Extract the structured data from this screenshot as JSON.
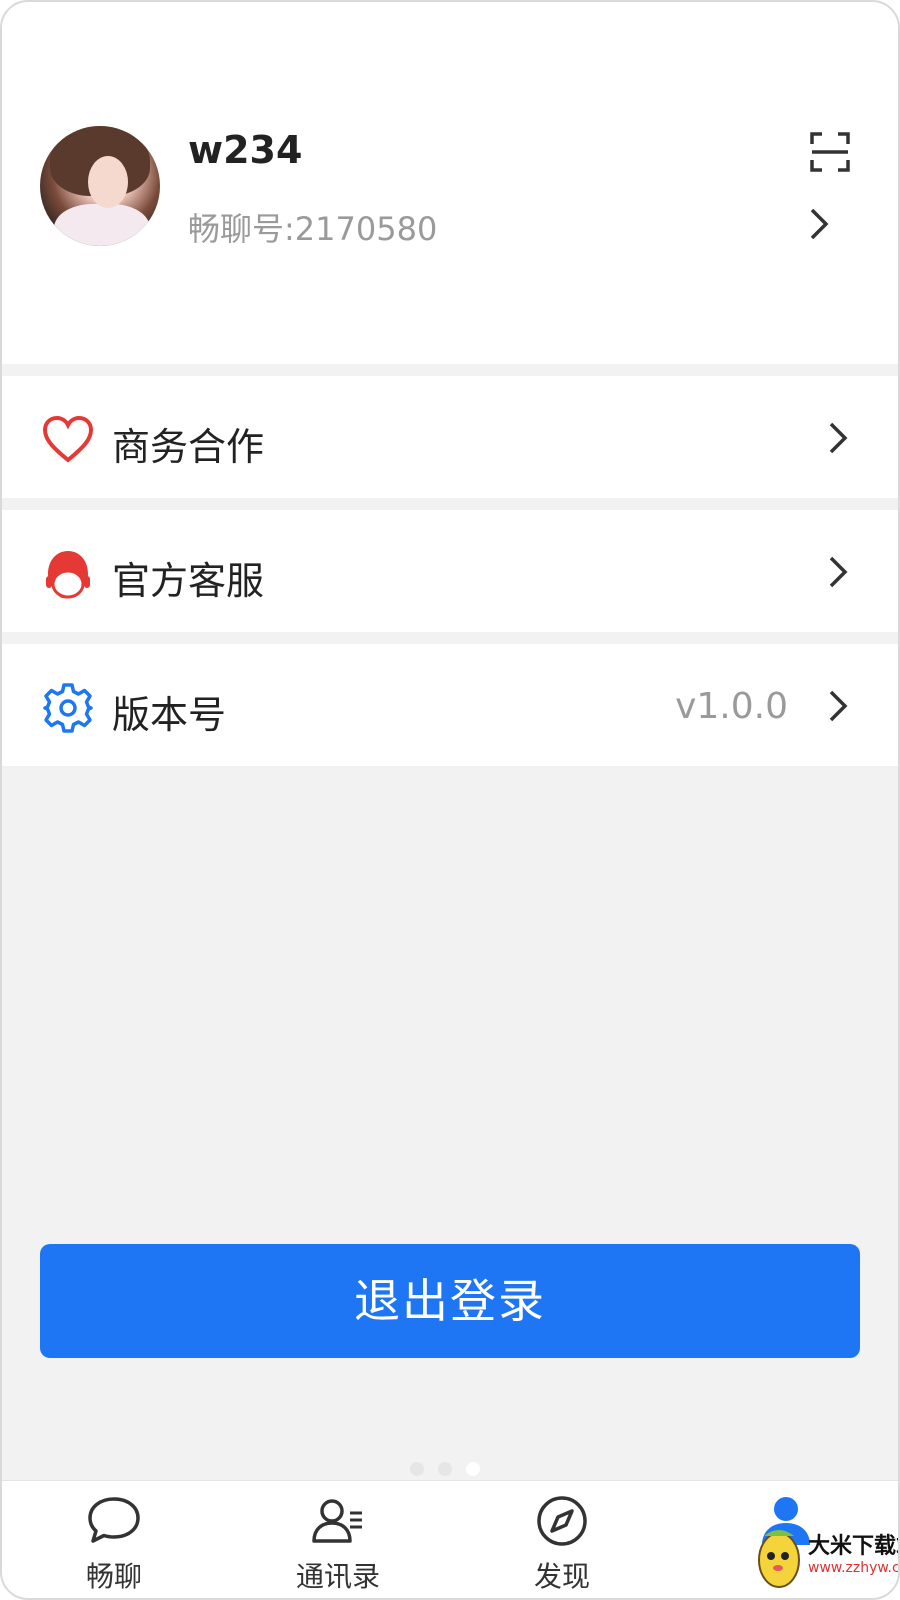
{
  "profile": {
    "username": "w234",
    "account_id": "畅聊号:2170580"
  },
  "menu": [
    {
      "label": "商务合作",
      "icon": "heart-icon",
      "icon_color": "#e53935"
    },
    {
      "label": "官方客服",
      "icon": "customer-service-icon",
      "icon_color": "#e53935"
    },
    {
      "label": "版本号",
      "icon": "gear-icon",
      "icon_color": "#1e76f5",
      "value": "v1.0.0"
    }
  ],
  "logout": {
    "label": "退出登录",
    "color": "#1e76f5"
  },
  "tabs": [
    {
      "label": "畅聊",
      "icon": "chat-bubble-icon",
      "active": false
    },
    {
      "label": "通讯录",
      "icon": "contacts-icon",
      "active": false
    },
    {
      "label": "发现",
      "icon": "compass-icon",
      "active": false
    },
    {
      "label": "",
      "icon": "user-icon",
      "active": true
    }
  ],
  "page_indicator": {
    "count": 3,
    "active_index": 2
  },
  "watermark": {
    "title": "大米下载站",
    "url": "www.zzhyw.com"
  },
  "colors": {
    "accent": "#1e76f5",
    "background": "#f2f2f2",
    "muted_text": "#9a9a9a"
  }
}
